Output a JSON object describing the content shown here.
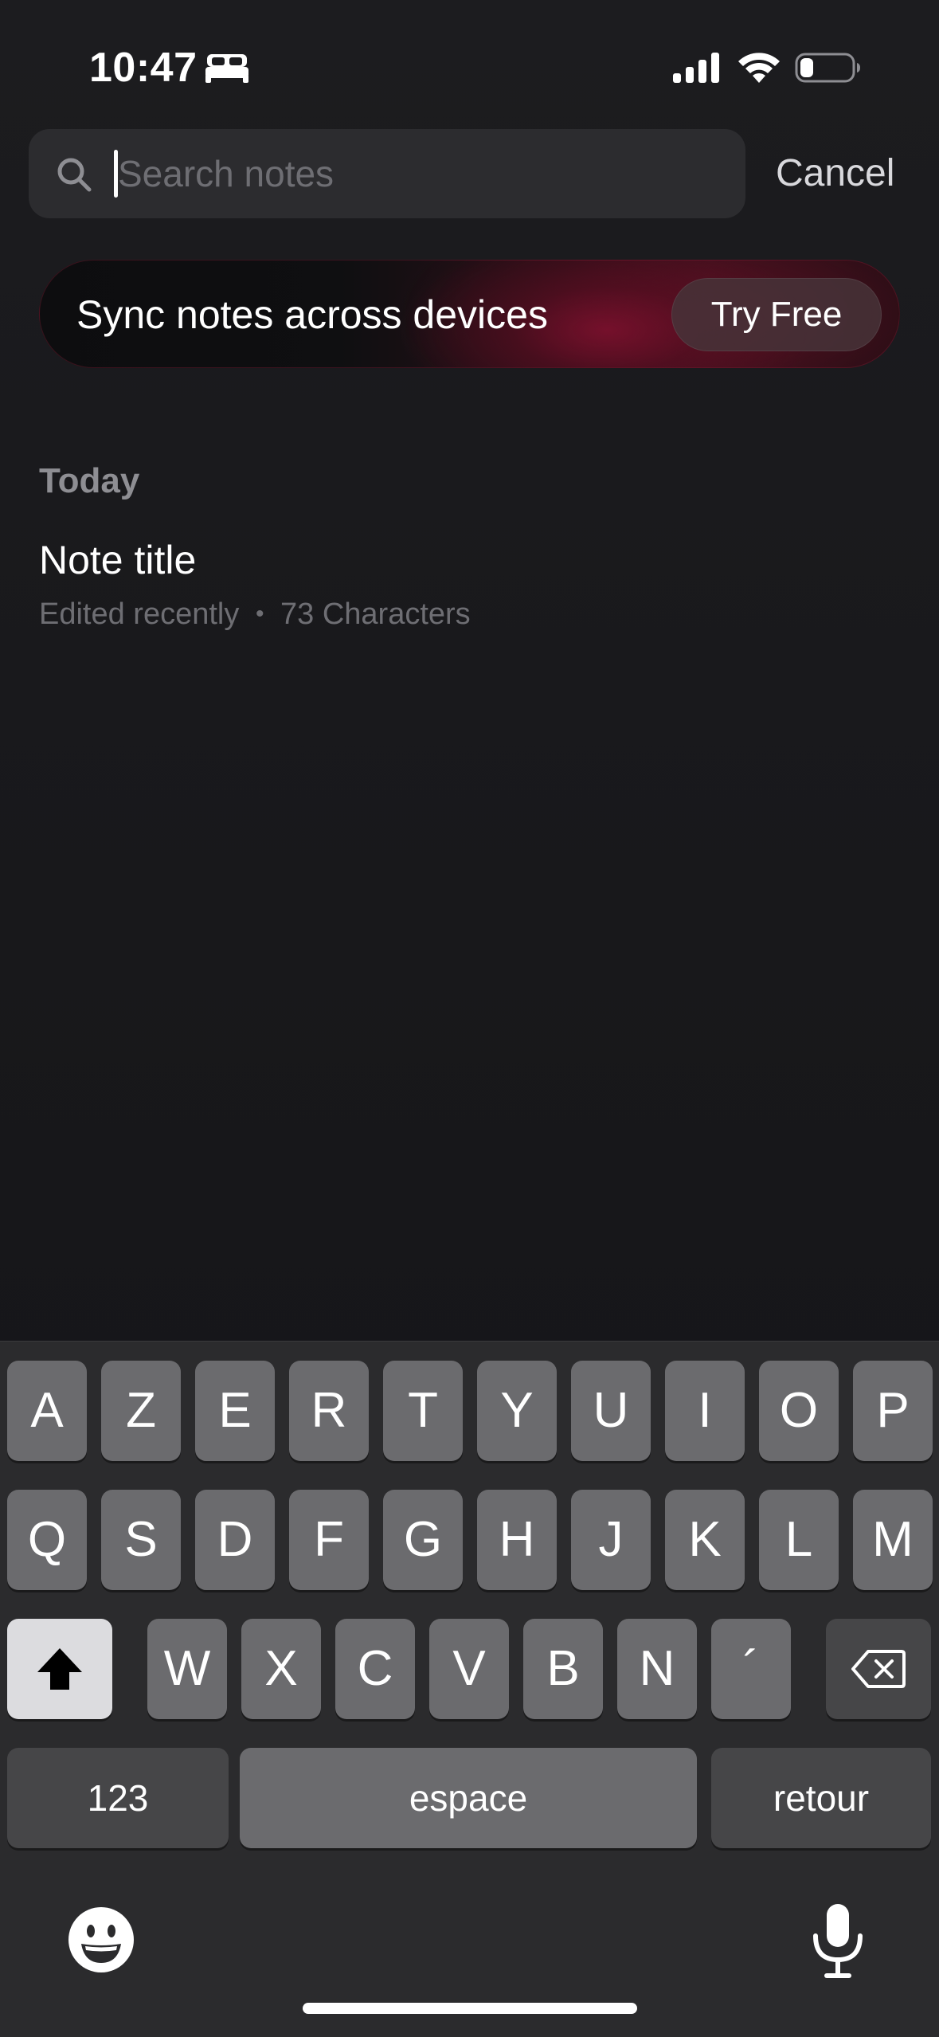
{
  "status_bar": {
    "time": "10:47",
    "focus_icon": "bed-icon",
    "signal_icon": "cellular-signal-icon",
    "wifi_icon": "wifi-icon",
    "battery_icon": "battery-icon",
    "battery_level": 0.25
  },
  "search": {
    "placeholder": "Search notes",
    "value": "",
    "cancel_label": "Cancel"
  },
  "promo": {
    "text": "Sync notes across devices",
    "button_label": "Try Free",
    "accent_color": "#7a1030"
  },
  "notes_list": {
    "section_label": "Today",
    "notes": [
      {
        "title": "Note title",
        "edited": "Edited recently",
        "separator": "•",
        "characters": "73 Characters"
      }
    ]
  },
  "keyboard": {
    "row1": [
      "A",
      "Z",
      "E",
      "R",
      "T",
      "Y",
      "U",
      "I",
      "O",
      "P"
    ],
    "row2": [
      "Q",
      "S",
      "D",
      "F",
      "G",
      "H",
      "J",
      "K",
      "L",
      "M"
    ],
    "row3": [
      "W",
      "X",
      "C",
      "V",
      "B",
      "N",
      "´"
    ],
    "numbers_label": "123",
    "space_label": "espace",
    "return_label": "retour",
    "shift_icon": "shift-icon",
    "delete_icon": "delete-icon",
    "emoji_icon": "emoji-icon",
    "mic_icon": "microphone-icon"
  }
}
